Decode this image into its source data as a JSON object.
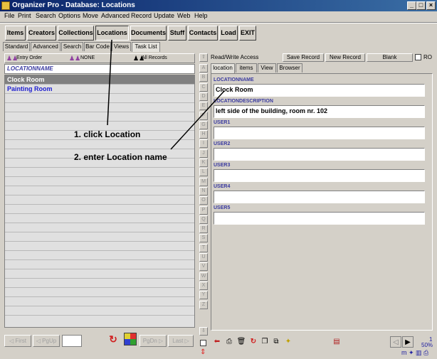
{
  "window": {
    "title": "Organizer Pro - Database: Locations",
    "controls": [
      "_",
      "□",
      "×"
    ]
  },
  "menu": [
    "File",
    "Print",
    "Search",
    "Options",
    "Move",
    "Advanced",
    "Record",
    "Update",
    "Web",
    "Help"
  ],
  "toolbar": [
    "Items",
    "Creators",
    "Collections",
    "Locations",
    "Documents",
    "Stuff",
    "Contacts",
    "Load",
    "EXIT"
  ],
  "left_tabs": [
    "Standard",
    "Advanced",
    "Search",
    "Bar Code",
    "Views",
    "Task List"
  ],
  "list_header": {
    "sort": "Entry Order",
    "filter": "NONE",
    "scope": "All Records"
  },
  "list": {
    "column": "LOCATIONNAME",
    "rows": [
      {
        "text": "Clock Room",
        "selected": true
      },
      {
        "text": "Painting Room",
        "selected": false
      }
    ]
  },
  "nav": {
    "first": "First",
    "pgup": "PgUp",
    "pgdn": "PgDn",
    "last": "Last"
  },
  "alphabet": [
    "A",
    "B",
    "C",
    "D",
    "E",
    "F",
    "G",
    "H",
    "I",
    "J",
    "K",
    "L",
    "M",
    "N",
    "O",
    "P",
    "Q",
    "R",
    "S",
    "T",
    "U",
    "V",
    "W",
    "X",
    "Y",
    "Z"
  ],
  "right_top": {
    "access": "Read/Write Access",
    "save": "Save Record",
    "new": "New Record",
    "blank": "Blank",
    "ro": "RO"
  },
  "right_tabs": [
    "location",
    "items",
    "View",
    "Browser"
  ],
  "fields": [
    {
      "label": "LOCATIONNAME",
      "value": "Clock Room"
    },
    {
      "label": "LOCATIONDESCRIPTION",
      "value": "left side of the building, room nr. 102"
    },
    {
      "label": "USER1",
      "value": ""
    },
    {
      "label": "USER2",
      "value": ""
    },
    {
      "label": "USER3",
      "value": ""
    },
    {
      "label": "USER4",
      "value": ""
    },
    {
      "label": "USER5",
      "value": ""
    }
  ],
  "status": {
    "count": "1",
    "zoom": "50%"
  },
  "annotations": {
    "step1": "1. click Location",
    "step2": "2. enter Location name"
  },
  "colors": {
    "titlebar": "#0a246a",
    "face": "#d4d0c8",
    "label": "#3a3aa0",
    "link": "#2020d0"
  }
}
